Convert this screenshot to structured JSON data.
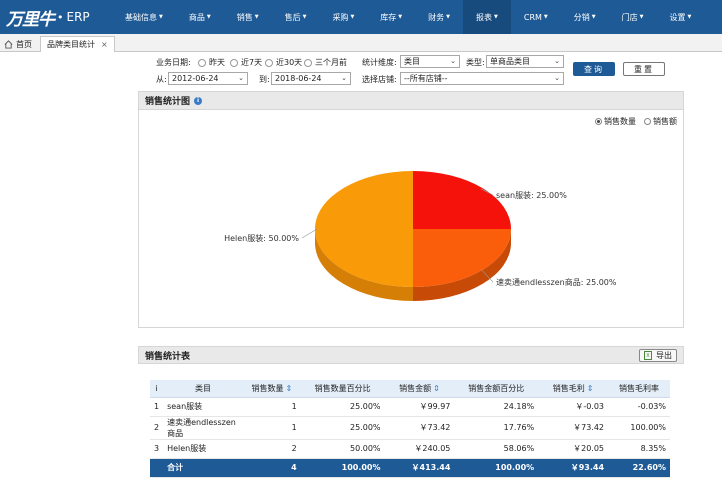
{
  "logo": {
    "brand": "万里牛",
    "suffix": "ERP"
  },
  "nav": [
    {
      "label": "基础信息",
      "active": false
    },
    {
      "label": "商品",
      "active": false
    },
    {
      "label": "销售",
      "active": false
    },
    {
      "label": "售后",
      "active": false
    },
    {
      "label": "采购",
      "active": false
    },
    {
      "label": "库存",
      "active": false
    },
    {
      "label": "财务",
      "active": false
    },
    {
      "label": "报表",
      "active": true
    },
    {
      "label": "CRM",
      "active": false
    },
    {
      "label": "分销",
      "active": false
    },
    {
      "label": "门店",
      "active": false
    },
    {
      "label": "设置",
      "active": false
    }
  ],
  "tabs": {
    "home": "首页",
    "current": "品牌类目统计",
    "close": "×"
  },
  "filters": {
    "date_label": "业务日期:",
    "date_options": [
      "昨天",
      "近7天",
      "近30天",
      "三个月前"
    ],
    "from_label": "从:",
    "from_value": "2012-06-24",
    "to_label": "到:",
    "to_value": "2018-06-24",
    "dimension_label": "统计维度:",
    "dimension_value": "类目",
    "type_label": "类型:",
    "type_value": "单商品类目",
    "store_label": "选择店铺:",
    "store_value": "--所有店铺--",
    "query_button": "查询",
    "reset_button": "重置"
  },
  "chart_panel": {
    "title": "销售统计图",
    "info_icon": "i",
    "radio_quantity": "销售数量",
    "radio_amount": "销售额"
  },
  "chart_data": {
    "type": "pie",
    "categories": [
      "sean服装",
      "速卖通endlesszen商品",
      "Helen服装"
    ],
    "values": [
      25.0,
      25.0,
      50.0
    ],
    "labels": [
      "sean服装: 25.00%",
      "速卖通endlesszen商品: 25.00%",
      "Helen服装: 50.00%"
    ],
    "colors": [
      "#f5120a",
      "#fa5e0a",
      "#f99a09"
    ],
    "side_colors": [
      "#b80d06",
      "#c84a07",
      "#d67f06"
    ]
  },
  "table_panel": {
    "title": "销售统计表",
    "export_button": "导出",
    "headers": [
      "i",
      "类目",
      "销售数量",
      "销售数量百分比",
      "销售金额",
      "销售金额百分比",
      "销售毛利",
      "销售毛利率"
    ],
    "rows": [
      [
        "1",
        "sean服装",
        "1",
        "25.00%",
        "￥99.97",
        "24.18%",
        "￥-0.03",
        "-0.03%"
      ],
      [
        "2",
        "速卖通endlesszen商品",
        "1",
        "25.00%",
        "￥73.42",
        "17.76%",
        "￥73.42",
        "100.00%"
      ],
      [
        "3",
        "Helen服装",
        "2",
        "50.00%",
        "￥240.05",
        "58.06%",
        "￥20.05",
        "8.35%"
      ]
    ],
    "total": [
      "",
      "合计",
      "4",
      "100.00%",
      "￥413.44",
      "100.00%",
      "￥93.44",
      "22.60%"
    ]
  }
}
